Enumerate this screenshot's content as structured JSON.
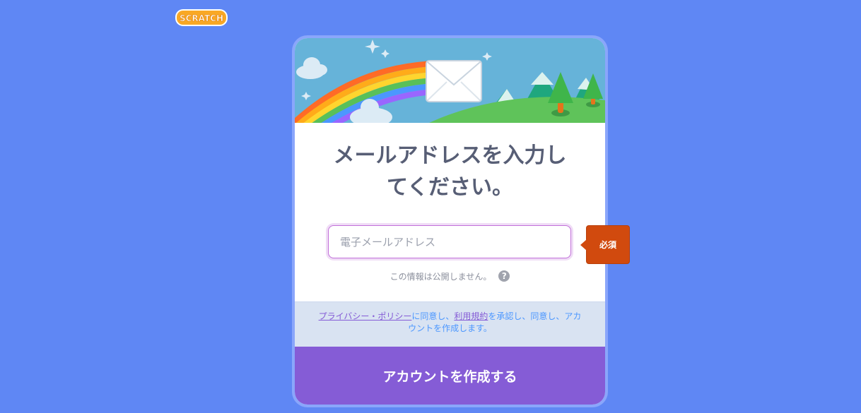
{
  "logo": {
    "text": "SCRATCH",
    "icon": "scratch-logo"
  },
  "signup": {
    "title_line1": "メールアドレスを入力し",
    "title_line2": "てください。",
    "email_placeholder": "電子メールアドレス",
    "email_value": "",
    "privacy_note": "この情報は公開しません。",
    "help_glyph": "?",
    "required_label": "必須",
    "terms": {
      "privacy_link": "プライバシー・ポリシー",
      "text1": "に同意し、",
      "tos_link": "利用規約",
      "text2": "を承認し、同意し、アカウントを作成します。"
    },
    "create_button": "アカウントを作成する"
  },
  "colors": {
    "background": "#5f87f4",
    "card_border": "#8aa6fb",
    "title": "#575e75",
    "terms_bg": "#d9e3f2",
    "terms_text": "#4c97ff",
    "link": "#855cd6",
    "button": "#855cd6",
    "required_tip": "#d14a0e"
  }
}
